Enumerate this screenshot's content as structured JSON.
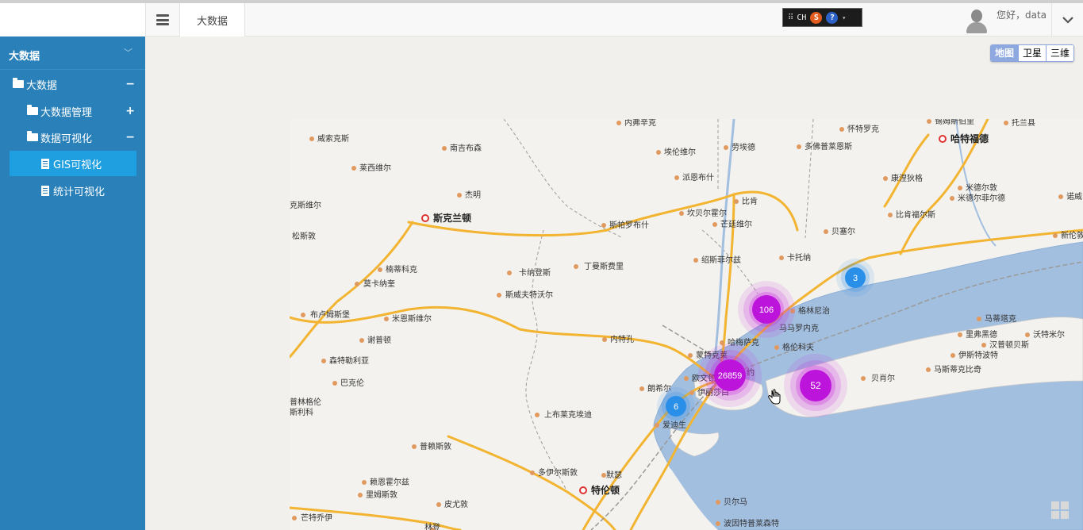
{
  "header": {
    "tab_label": "大数据",
    "ime": {
      "lang": "CH",
      "s_glyph": "S",
      "q_glyph": "?"
    },
    "greeting": "您好，data"
  },
  "sidebar": {
    "title": "大数据",
    "items": [
      {
        "label": "大数据",
        "toggle": "−",
        "level": 1
      },
      {
        "label": "大数据管理",
        "toggle": "+",
        "level": 2
      },
      {
        "label": "数据可视化",
        "toggle": "−",
        "level": 2
      },
      {
        "label": "GIS可视化",
        "active": true,
        "level": 3
      },
      {
        "label": "统计可视化",
        "level": 3
      }
    ]
  },
  "map": {
    "type_buttons": [
      "地图",
      "卫星",
      "三维"
    ],
    "selected_type": "地图",
    "clusters": [
      {
        "count": "106",
        "color": "#c51fe0"
      },
      {
        "count": "26859",
        "color": "#c51fe0"
      },
      {
        "count": "52",
        "color": "#c51fe0"
      },
      {
        "count": "3",
        "color": "#2a8fe8"
      },
      {
        "count": "6",
        "color": "#2a8fe8"
      }
    ],
    "cities_major": [
      "斯克兰顿",
      "哈特福德",
      "特伦顿"
    ],
    "places": [
      "内弗辛克",
      "锡姆斯伯里",
      "托兰县",
      "怀特罗克",
      "威索克斯",
      "南吉布森",
      "埃伦维尔",
      "劳埃德",
      "多佛普莱恩斯",
      "莱西维尔",
      "派恩布什",
      "杰明",
      "康涅狄格",
      "米德尔敦",
      "米德尔菲尔德",
      "诺威",
      "克斯维尔",
      "比肯",
      "坎贝尔霍尔",
      "斯帕罗布什",
      "芒廷维尔",
      "比肯福尔斯",
      "松斯敦",
      "贝塞尔",
      "新伦敦",
      "卡托纳",
      "绍斯菲尔兹",
      "楠蒂科克",
      "卡纳登斯",
      "丁曼斯费里",
      "莫卡纳奎",
      "斯威夫特沃尔",
      "格林尼治",
      "马马罗内克",
      "马蒂塔克",
      "布卢姆斯堡",
      "米恩斯维尔",
      "里弗黑德",
      "沃特米尔",
      "谢普顿",
      "内特孔",
      "哈梅萨克",
      "格伦科夫",
      "汉普顿贝斯",
      "森特勒利亚",
      "蒙特克莱",
      "伊斯特波特",
      "巴克伦",
      "欧文顿",
      "伊丽莎白",
      "马斯蒂克比奇",
      "贝肖尔",
      "朗希尔",
      "普林格伦",
      "斯利科",
      "爱迪生",
      "上布莱克埃迪",
      "普赖斯敦",
      "多伊尔斯敦",
      "默瑟",
      "赖恩霍尔兹",
      "里姆斯敦",
      "皮尤敦",
      "贝尔马",
      "芒特乔伊",
      "林登",
      "波因特普莱森特",
      "约"
    ]
  },
  "icons": {
    "hamburger": "hamburger-icon",
    "dropdown": "chevron-down-icon",
    "folder": "folder-icon",
    "doc": "document-icon",
    "hand": "hand-cursor-icon",
    "grid": "grid-icon"
  },
  "colors": {
    "sidebar_bg": "#2a80b9",
    "sidebar_active": "#1f9ee0",
    "water": "#a3bfe0",
    "land": "#f1f0ec",
    "road_major": "#f2b431",
    "cluster_purple": "#c51fe0",
    "cluster_blue": "#2a8fe8"
  }
}
